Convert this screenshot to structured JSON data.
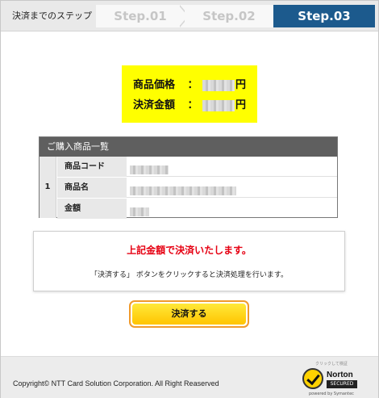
{
  "steps": {
    "lead": "決済までのステップ",
    "items": [
      "Step.01",
      "Step.02",
      "Step.03"
    ],
    "active_index": 2
  },
  "price": {
    "item_price_label": "商品価格",
    "total_label": "決済金額",
    "separator": "：",
    "currency": "円"
  },
  "items_table": {
    "heading": "ご購入商品一覧",
    "row_number": "1",
    "fields": [
      "商品コード",
      "商品名",
      "金額"
    ]
  },
  "message": {
    "title": "上記金額で決済いたします。",
    "instruction": "「決済する」 ボタンをクリックすると決済処理を行います。"
  },
  "pay_button": {
    "label": "決済する"
  },
  "footer": {
    "copyright": "Copyright© NTT Card Solution Corporation. All Right Reaserved",
    "norton": {
      "click_text": "クリックして検証",
      "brand": "Norton",
      "secured": "SECURED",
      "powered": "powered by Symantec"
    }
  },
  "colors": {
    "active_step": "#1c5a8d",
    "price_highlight": "#ffff00",
    "message_title": "#e60012",
    "button_border": "#f09a2b"
  }
}
